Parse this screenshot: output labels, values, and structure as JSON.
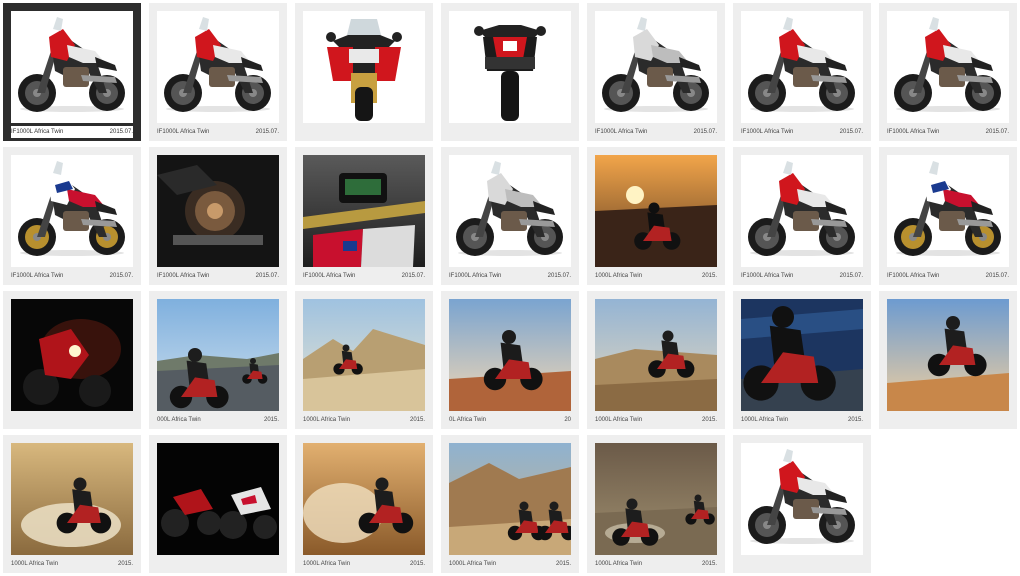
{
  "tiles": [
    {
      "title": "IF1000L Africa Twin",
      "date": "2015.07.",
      "scene": "bike-side-red",
      "bg": "#ffffff",
      "selected": true
    },
    {
      "title": "IF1000L Africa Twin",
      "date": "2015.07.",
      "scene": "bike-side-red",
      "bg": "#ffffff"
    },
    {
      "title": "",
      "date": "",
      "scene": "bike-front",
      "bg": "#ffffff"
    },
    {
      "title": "",
      "date": "",
      "scene": "bike-rear",
      "bg": "#ffffff"
    },
    {
      "title": "IF1000L Africa Twin",
      "date": "2015.07.",
      "scene": "bike-side-silver",
      "bg": "#ffffff"
    },
    {
      "title": "IF1000L Africa Twin",
      "date": "2015.07.",
      "scene": "bike-side-red",
      "bg": "#ffffff"
    },
    {
      "title": "IF1000L Africa Twin",
      "date": "2015.07.",
      "scene": "bike-side-red",
      "bg": "#ffffff"
    },
    {
      "title": "IF1000L Africa Twin",
      "date": "2015.07.",
      "scene": "bike-side-tricolor",
      "bg": "#ffffff"
    },
    {
      "title": "IF1000L Africa Twin",
      "date": "2015.07.",
      "scene": "engine-closeup",
      "bg": "#1a1a1a"
    },
    {
      "title": "IF1000L Africa Twin",
      "date": "2015.07.",
      "scene": "cockpit-closeup",
      "bg": "#3a3a3a"
    },
    {
      "title": "IF1000L Africa Twin",
      "date": "2015.07.",
      "scene": "bike-side-silver",
      "bg": "#ffffff"
    },
    {
      "title": "1000L Africa Twin",
      "date": "2015.",
      "scene": "sunset-rider",
      "bg": "#d98a3a"
    },
    {
      "title": "IF1000L Africa Twin",
      "date": "2015.07.",
      "scene": "bike-side-red",
      "bg": "#ffffff"
    },
    {
      "title": "IF1000L Africa Twin",
      "date": "2015.07.",
      "scene": "bike-side-tricolor",
      "bg": "#ffffff"
    },
    {
      "title": "",
      "date": "",
      "scene": "dark-studio",
      "bg": "#0d0d0d"
    },
    {
      "title": "000L Africa Twin",
      "date": "2015.",
      "scene": "road-riders",
      "bg": "#7fa8c9"
    },
    {
      "title": "1000L Africa Twin",
      "date": "2015.",
      "scene": "desert-valley",
      "bg": "#a9c3da"
    },
    {
      "title": "0L Africa Twin",
      "date": "20",
      "scene": "desert-wheelie",
      "bg": "#8fb0d0"
    },
    {
      "title": "1000L Africa Twin",
      "date": "2015.",
      "scene": "desert-rider",
      "bg": "#9bb7cf"
    },
    {
      "title": "1000L Africa Twin",
      "date": "2015.",
      "scene": "blue-road",
      "bg": "#1e3d6b"
    },
    {
      "title": "",
      "date": "",
      "scene": "desert-jump",
      "bg": "#7da6cf"
    },
    {
      "title": "1000L Africa Twin",
      "date": "2015.",
      "scene": "water-splash",
      "bg": "#c9a66a"
    },
    {
      "title": "",
      "date": "",
      "scene": "dark-pair",
      "bg": "#050505"
    },
    {
      "title": "1000L Africa Twin",
      "date": "2015.",
      "scene": "dust-rider",
      "bg": "#c9964f"
    },
    {
      "title": "1000L Africa Twin",
      "date": "2015.",
      "scene": "canyon-pair",
      "bg": "#8aa7c0"
    },
    {
      "title": "1000L Africa Twin",
      "date": "2015.",
      "scene": "river-pair",
      "bg": "#8a7a60"
    },
    {
      "title": "",
      "date": "",
      "scene": "bike-side-red",
      "bg": "#ffffff"
    }
  ]
}
